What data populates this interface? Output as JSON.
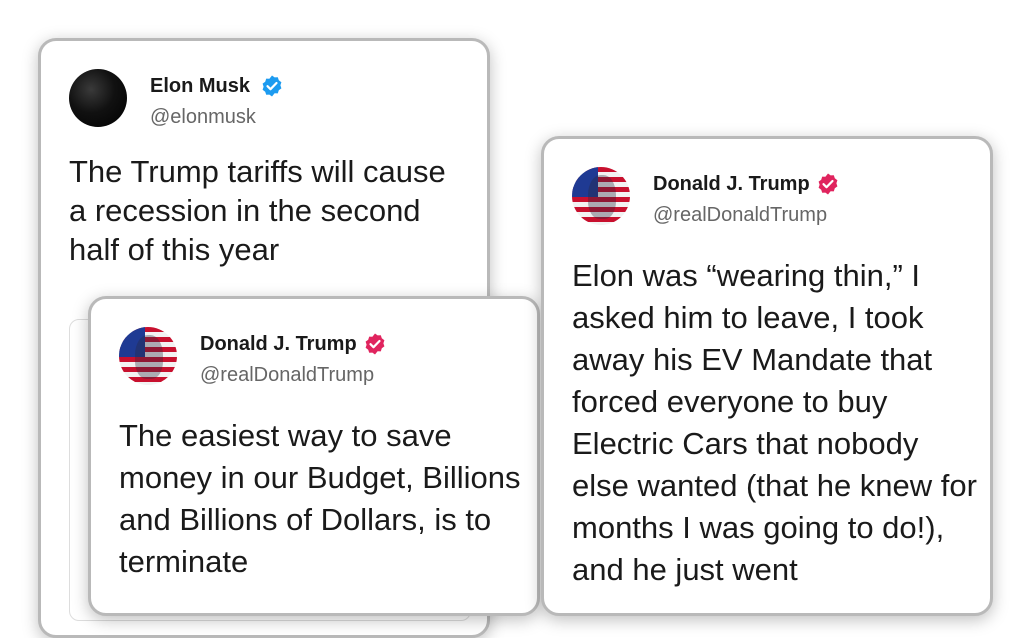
{
  "tweets": {
    "elon": {
      "name": "Elon Musk",
      "handle": "@elonmusk",
      "text": "The Trump tariffs will cause a recession in the second half of this year",
      "badge_color": "#1d9bf0"
    },
    "trump_1": {
      "name": "Donald J. Trump",
      "handle": "@realDonaldTrump",
      "text": "The easiest way to save money in our Budget, Billions and Billions of Dollars, is to terminate",
      "badge_color": "#e0245e"
    },
    "trump_2": {
      "name": "Donald J. Trump",
      "handle": "@realDonaldTrump",
      "text": "Elon was “wearing thin,” I asked him to leave, I took away his EV Mandate that forced everyone to buy Electric Cars that nobody else wanted (that he knew for months I was going to do!), and he just went",
      "badge_color": "#e0245e"
    }
  },
  "icons": {
    "verified": "verified-badge-icon",
    "avatar_elon": "dark-sphere-avatar",
    "avatar_trump": "flag-portrait-avatar"
  }
}
